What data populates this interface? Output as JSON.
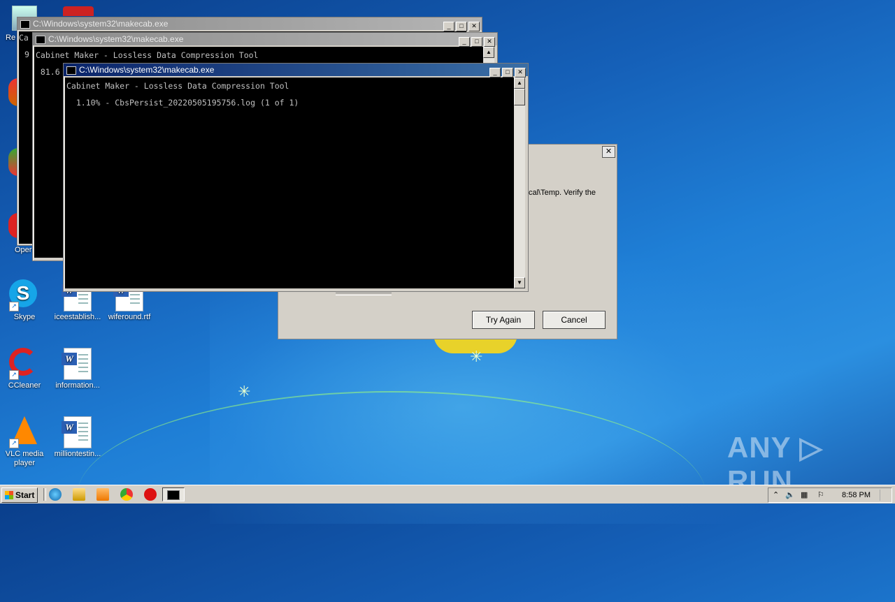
{
  "desktop": {
    "icons": [
      {
        "label": "Skype"
      },
      {
        "label": "iceestablish..."
      },
      {
        "label": "wiferound.rtf"
      },
      {
        "label": "CCleaner"
      },
      {
        "label": "information..."
      },
      {
        "label": "VLC media player"
      },
      {
        "label": "milliontestin..."
      },
      {
        "label": "Re"
      },
      {
        "label": "Oper"
      }
    ],
    "watermark": "ANY ▷ RUN"
  },
  "windows": {
    "back": {
      "title": "C:\\Windows\\system32\\makecab.exe",
      "frag1": "Ca",
      "frag2": "9"
    },
    "middle": {
      "title": "C:\\Windows\\system32\\makecab.exe",
      "line1": "Cabinet Maker - Lossless Data Compression Tool",
      "line2": " 81.6"
    },
    "front": {
      "title": "C:\\Windows\\system32\\makecab.exe",
      "line1": "Cabinet Maker - Lossless Data Compression Tool",
      "line2": "  1.10% - CbsPersist_20220505195756.log (1 of 1)"
    }
  },
  "dialog": {
    "message_fragment": "cal\\Temp. Verify the",
    "try_again": "Try Again",
    "cancel": "Cancel"
  },
  "taskbar": {
    "start": "Start",
    "clock": "8:58 PM"
  }
}
